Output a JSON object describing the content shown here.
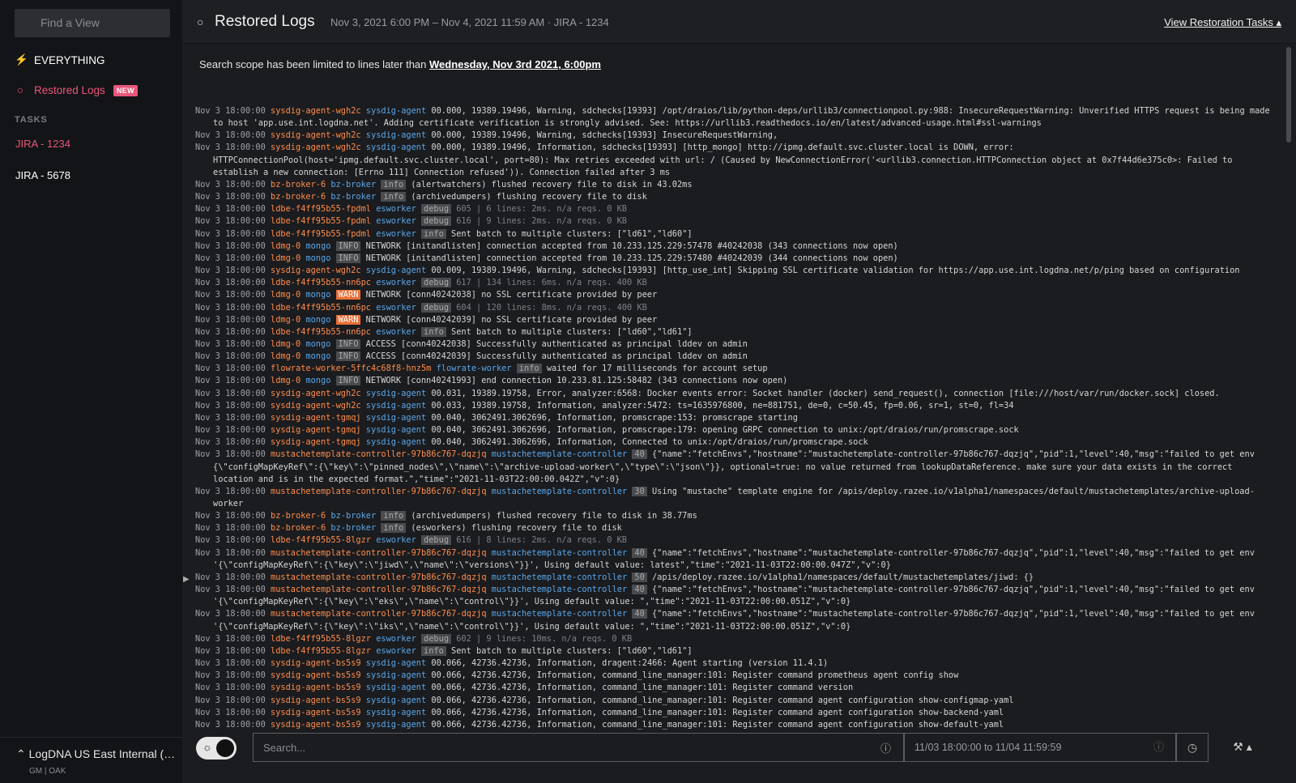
{
  "sidebar": {
    "search_placeholder": "Find a View",
    "everything_label": "EVERYTHING",
    "restored_label": "Restored Logs",
    "new_badge": "NEW",
    "tasks_title": "TASKS",
    "tasks": [
      "JIRA - 1234",
      "JIRA - 5678"
    ],
    "org_name": "LogDNA US East Internal (u…",
    "org_meta": "GM | OAK"
  },
  "header": {
    "title": "Restored Logs",
    "range": "Nov 3, 2021 6:00 PM – Nov 4, 2021 11:59 AM · JIRA - 1234",
    "link": "View Restoration Tasks"
  },
  "scope": {
    "prefix": "Search scope has been limited to lines later than ",
    "date": "Wednesday, Nov 3rd 2021, 6:00pm"
  },
  "footer": {
    "search_placeholder": "Search...",
    "time_range": "11/03 18:00:00 to 11/04 11:59:59"
  },
  "colors": {
    "accent": "#e9567a",
    "host": "#ff8c4a",
    "app": "#5aa6e8",
    "warn": "#e96f36"
  },
  "logs": [
    {
      "ts": "Nov 3 18:00:00",
      "host": "sysdig-agent-wgh2c",
      "app": "sysdig-agent",
      "lvl": "",
      "msg": "00.000, 19389.19496, Warning, sdchecks[19393] /opt/draios/lib/python-deps/urllib3/connectionpool.py:988: InsecureRequestWarning: Unverified HTTPS request is being made to host 'app.use.int.logdna.net'. Adding certificate verification is strongly advised. See: https://urllib3.readthedocs.io/en/latest/advanced-usage.html#ssl-warnings"
    },
    {
      "ts": "Nov 3 18:00:00",
      "host": "sysdig-agent-wgh2c",
      "app": "sysdig-agent",
      "lvl": "",
      "msg": "00.000, 19389.19496, Warning, sdchecks[19393] InsecureRequestWarning,"
    },
    {
      "ts": "Nov 3 18:00:00",
      "host": "sysdig-agent-wgh2c",
      "app": "sysdig-agent",
      "lvl": "",
      "msg": "00.000, 19389.19496, Information, sdchecks[19393] [http_mongo] http://ipmg.default.svc.cluster.local is DOWN, error: HTTPConnectionPool(host='ipmg.default.svc.cluster.local', port=80): Max retries exceeded with url: / (Caused by NewConnectionError('<urllib3.connection.HTTPConnection object at 0x7f44d6e375c0>: Failed to establish a new connection: [Errno 111] Connection refused')). Connection failed after 3 ms"
    },
    {
      "ts": "Nov 3 18:00:00",
      "host": "bz-broker-6",
      "app": "bz-broker",
      "lvl": "info",
      "msg": "(alertwatchers) flushed recovery file to disk in 43.02ms"
    },
    {
      "ts": "Nov 3 18:00:00",
      "host": "bz-broker-6",
      "app": "bz-broker",
      "lvl": "info",
      "msg": "(archivedumpers) flushing recovery file to disk"
    },
    {
      "ts": "Nov 3 18:00:00",
      "host": "ldbe-f4ff95b55-fpdml",
      "app": "esworker",
      "lvl": "debug",
      "msg": "605 | 6 lines: 2ms. n/a reqs. 0 KB",
      "dim": true
    },
    {
      "ts": "Nov 3 18:00:00",
      "host": "ldbe-f4ff95b55-fpdml",
      "app": "esworker",
      "lvl": "debug",
      "msg": "616 | 9 lines: 2ms. n/a reqs. 0 KB",
      "dim": true
    },
    {
      "ts": "Nov 3 18:00:00",
      "host": "ldbe-f4ff95b55-fpdml",
      "app": "esworker",
      "lvl": "info",
      "msg": "Sent batch to multiple clusters: [\"ld61\",\"ld60\"]"
    },
    {
      "ts": "Nov 3 18:00:00",
      "host": "ldmg-0",
      "app": "mongo",
      "lvl": "INFO",
      "msg": "NETWORK [initandlisten] connection accepted from 10.233.125.229:57478 #40242038 (343 connections now open)"
    },
    {
      "ts": "Nov 3 18:00:00",
      "host": "ldmg-0",
      "app": "mongo",
      "lvl": "INFO",
      "msg": "NETWORK [initandlisten] connection accepted from 10.233.125.229:57480 #40242039 (344 connections now open)"
    },
    {
      "ts": "Nov 3 18:00:00",
      "host": "sysdig-agent-wgh2c",
      "app": "sysdig-agent",
      "lvl": "",
      "msg": "00.009, 19389.19496, Warning, sdchecks[19393] [http_use_int] Skipping SSL certificate validation for https://app.use.int.logdna.net/p/ping based on configuration"
    },
    {
      "ts": "Nov 3 18:00:00",
      "host": "ldbe-f4ff95b55-nn6pc",
      "app": "esworker",
      "lvl": "debug",
      "msg": "617 | 134 lines: 6ms. n/a reqs. 400 KB",
      "dim": true
    },
    {
      "ts": "Nov 3 18:00:00",
      "host": "ldmg-0",
      "app": "mongo",
      "lvl": "WARN",
      "msg": "NETWORK [conn40242038] no SSL certificate provided by peer"
    },
    {
      "ts": "Nov 3 18:00:00",
      "host": "ldbe-f4ff95b55-nn6pc",
      "app": "esworker",
      "lvl": "debug",
      "msg": "604 | 120 lines: 8ms. n/a reqs. 400 KB",
      "dim": true
    },
    {
      "ts": "Nov 3 18:00:00",
      "host": "ldmg-0",
      "app": "mongo",
      "lvl": "WARN",
      "msg": "NETWORK [conn40242039] no SSL certificate provided by peer"
    },
    {
      "ts": "Nov 3 18:00:00",
      "host": "ldbe-f4ff95b55-nn6pc",
      "app": "esworker",
      "lvl": "info",
      "msg": "Sent batch to multiple clusters: [\"ld60\",\"ld61\"]"
    },
    {
      "ts": "Nov 3 18:00:00",
      "host": "ldmg-0",
      "app": "mongo",
      "lvl": "INFO",
      "msg": "ACCESS [conn40242038] Successfully authenticated as principal lddev on admin"
    },
    {
      "ts": "Nov 3 18:00:00",
      "host": "ldmg-0",
      "app": "mongo",
      "lvl": "INFO",
      "msg": "ACCESS [conn40242039] Successfully authenticated as principal lddev on admin"
    },
    {
      "ts": "Nov 3 18:00:00",
      "host": "flowrate-worker-5ffc4c68f8-hnz5m",
      "app": "flowrate-worker",
      "lvl": "info",
      "msg": "waited for 17 milliseconds for account setup"
    },
    {
      "ts": "Nov 3 18:00:00",
      "host": "ldmg-0",
      "app": "mongo",
      "lvl": "INFO",
      "msg": "NETWORK [conn40241993] end connection 10.233.81.125:58482 (343 connections now open)"
    },
    {
      "ts": "Nov 3 18:00:00",
      "host": "sysdig-agent-wgh2c",
      "app": "sysdig-agent",
      "lvl": "",
      "msg": "00.031, 19389.19758, Error, analyzer:6568: Docker events error: Socket handler (docker) send_request(), connection [file:///host/var/run/docker.sock] closed."
    },
    {
      "ts": "Nov 3 18:00:00",
      "host": "sysdig-agent-wgh2c",
      "app": "sysdig-agent",
      "lvl": "",
      "msg": "00.033, 19389.19758, Information, analyzer:5472: ts=1635976800, ne=881751, de=0, c=50.45, fp=0.06, sr=1, st=0, fl=34"
    },
    {
      "ts": "Nov 3 18:00:00",
      "host": "sysdig-agent-tgmqj",
      "app": "sysdig-agent",
      "lvl": "",
      "msg": "00.040, 3062491.3062696, Information, promscrape:153: promscrape starting"
    },
    {
      "ts": "Nov 3 18:00:00",
      "host": "sysdig-agent-tgmqj",
      "app": "sysdig-agent",
      "lvl": "",
      "msg": "00.040, 3062491.3062696, Information, promscrape:179: opening GRPC connection to unix:/opt/draios/run/promscrape.sock"
    },
    {
      "ts": "Nov 3 18:00:00",
      "host": "sysdig-agent-tgmqj",
      "app": "sysdig-agent",
      "lvl": "",
      "msg": "00.040, 3062491.3062696, Information, Connected to unix:/opt/draios/run/promscrape.sock"
    },
    {
      "ts": "Nov 3 18:00:00",
      "host": "mustachetemplate-controller-97b86c767-dqzjq",
      "app": "mustachetemplate-controller",
      "lvl": "40",
      "msg": "{\"name\":\"fetchEnvs\",\"hostname\":\"mustachetemplate-controller-97b86c767-dqzjq\",\"pid\":1,\"level\":40,\"msg\":\"failed to get env {\\\"configMapKeyRef\\\":{\\\"key\\\":\\\"pinned_nodes\\\",\\\"name\\\":\\\"archive-upload-worker\\\",\\\"type\\\":\\\"json\\\"}}, optional=true: no value returned from lookupDataReference. make sure your data exists in the correct location and is in the expected format.\",\"time\":\"2021-11-03T22:00:00.042Z\",\"v\":0}"
    },
    {
      "ts": "Nov 3 18:00:00",
      "host": "mustachetemplate-controller-97b86c767-dqzjq",
      "app": "mustachetemplate-controller",
      "lvl": "30",
      "msg": "Using \"mustache\" template engine for /apis/deploy.razee.io/v1alpha1/namespaces/default/mustachetemplates/archive-upload-worker"
    },
    {
      "ts": "Nov 3 18:00:00",
      "host": "bz-broker-6",
      "app": "bz-broker",
      "lvl": "info",
      "msg": "(archivedumpers) flushed recovery file to disk in 38.77ms"
    },
    {
      "ts": "Nov 3 18:00:00",
      "host": "bz-broker-6",
      "app": "bz-broker",
      "lvl": "info",
      "msg": "(esworkers) flushing recovery file to disk"
    },
    {
      "ts": "Nov 3 18:00:00",
      "host": "ldbe-f4ff95b55-8lgzr",
      "app": "esworker",
      "lvl": "debug",
      "msg": "616 | 8 lines: 2ms. n/a reqs. 0 KB",
      "dim": true
    },
    {
      "ts": "Nov 3 18:00:00",
      "host": "mustachetemplate-controller-97b86c767-dqzjq",
      "app": "mustachetemplate-controller",
      "lvl": "40",
      "msg": "{\"name\":\"fetchEnvs\",\"hostname\":\"mustachetemplate-controller-97b86c767-dqzjq\",\"pid\":1,\"level\":40,\"msg\":\"failed to get env '{\\\"configMapKeyRef\\\":{\\\"key\\\":\\\"jiwd\\\",\\\"name\\\":\\\"versions\\\"}}', Using default value: latest\",\"time\":\"2021-11-03T22:00:00.047Z\",\"v\":0}"
    },
    {
      "ts": "Nov 3 18:00:00",
      "host": "mustachetemplate-controller-97b86c767-dqzjq",
      "app": "mustachetemplate-controller",
      "lvl": "50",
      "msg": "/apis/deploy.razee.io/v1alpha1/namespaces/default/mustachetemplates/jiwd: {}"
    },
    {
      "ts": "Nov 3 18:00:00",
      "host": "mustachetemplate-controller-97b86c767-dqzjq",
      "app": "mustachetemplate-controller",
      "lvl": "40",
      "msg": "{\"name\":\"fetchEnvs\",\"hostname\":\"mustachetemplate-controller-97b86c767-dqzjq\",\"pid\":1,\"level\":40,\"msg\":\"failed to get env '{\\\"configMapKeyRef\\\":{\\\"key\\\":\\\"eks\\\",\\\"name\\\":\\\"control\\\"}}', Using default value: \",\"time\":\"2021-11-03T22:00:00.051Z\",\"v\":0}"
    },
    {
      "ts": "Nov 3 18:00:00",
      "host": "mustachetemplate-controller-97b86c767-dqzjq",
      "app": "mustachetemplate-controller",
      "lvl": "40",
      "msg": "{\"name\":\"fetchEnvs\",\"hostname\":\"mustachetemplate-controller-97b86c767-dqzjq\",\"pid\":1,\"level\":40,\"msg\":\"failed to get env '{\\\"configMapKeyRef\\\":{\\\"key\\\":\\\"iks\\\",\\\"name\\\":\\\"control\\\"}}', Using default value: \",\"time\":\"2021-11-03T22:00:00.051Z\",\"v\":0}"
    },
    {
      "ts": "Nov 3 18:00:00",
      "host": "ldbe-f4ff95b55-8lgzr",
      "app": "esworker",
      "lvl": "debug",
      "msg": "602 | 9 lines: 10ms. n/a reqs. 0 KB",
      "dim": true
    },
    {
      "ts": "Nov 3 18:00:00",
      "host": "ldbe-f4ff95b55-8lgzr",
      "app": "esworker",
      "lvl": "info",
      "msg": "Sent batch to multiple clusters: [\"ld60\",\"ld61\"]"
    },
    {
      "ts": "Nov 3 18:00:00",
      "host": "sysdig-agent-bs5s9",
      "app": "sysdig-agent",
      "lvl": "",
      "msg": "00.066, 42736.42736, Information, dragent:2466: Agent starting (version 11.4.1)"
    },
    {
      "ts": "Nov 3 18:00:00",
      "host": "sysdig-agent-bs5s9",
      "app": "sysdig-agent",
      "lvl": "",
      "msg": "00.066, 42736.42736, Information, command_line_manager:101: Register command prometheus agent config show"
    },
    {
      "ts": "Nov 3 18:00:00",
      "host": "sysdig-agent-bs5s9",
      "app": "sysdig-agent",
      "lvl": "",
      "msg": "00.066, 42736.42736, Information, command_line_manager:101: Register command version"
    },
    {
      "ts": "Nov 3 18:00:00",
      "host": "sysdig-agent-bs5s9",
      "app": "sysdig-agent",
      "lvl": "",
      "msg": "00.066, 42736.42736, Information, command_line_manager:101: Register command agent configuration show-configmap-yaml"
    },
    {
      "ts": "Nov 3 18:00:00",
      "host": "sysdig-agent-bs5s9",
      "app": "sysdig-agent",
      "lvl": "",
      "msg": "00.066, 42736.42736, Information, command_line_manager:101: Register command agent configuration show-backend-yaml"
    },
    {
      "ts": "Nov 3 18:00:00",
      "host": "sysdig-agent-bs5s9",
      "app": "sysdig-agent",
      "lvl": "",
      "msg": "00.066, 42736.42736, Information, command_line_manager:101: Register command agent configuration show-default-yaml"
    }
  ]
}
